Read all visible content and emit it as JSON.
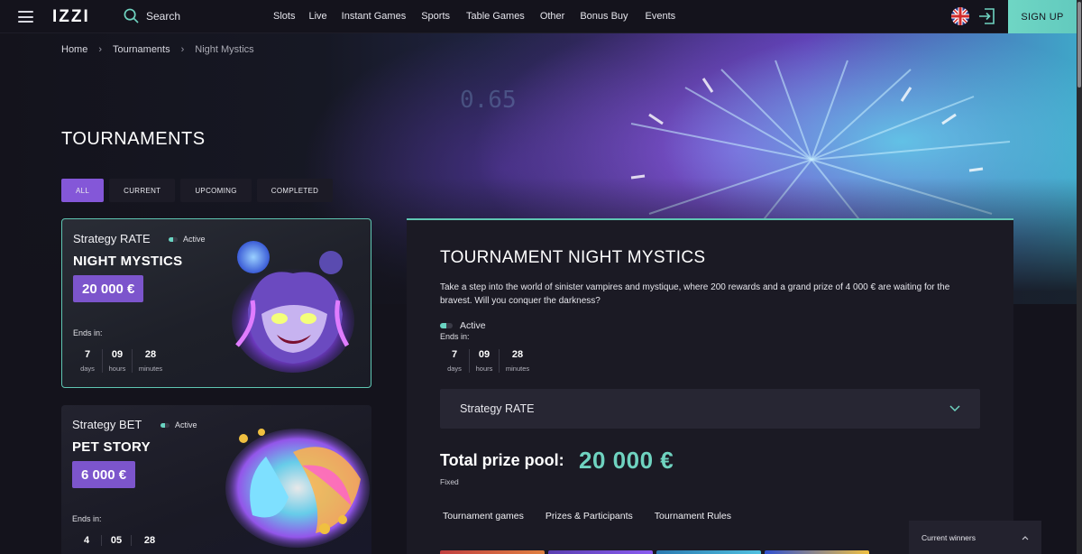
{
  "header": {
    "logo": "IZZI",
    "search_label": "Search",
    "nav": [
      "Slots",
      "Live",
      "Instant Games",
      "Sports",
      "Table Games",
      "Other",
      "Bonus Buy",
      "Events"
    ],
    "signup_label": "SIGN UP"
  },
  "breadcrumb": {
    "home": "Home",
    "tournaments": "Tournaments",
    "current": "Night Mystics"
  },
  "page_title": "TOURNAMENTS",
  "filters": [
    {
      "label": "ALL",
      "active": true
    },
    {
      "label": "CURRENT",
      "active": false
    },
    {
      "label": "UPCOMING",
      "active": false
    },
    {
      "label": "COMPLETED",
      "active": false
    }
  ],
  "cards": [
    {
      "type": "Strategy RATE",
      "status": "Active",
      "name": "NIGHT MYSTICS",
      "prize": "20 000 €",
      "ends_label": "Ends in:",
      "timer": {
        "days": "7",
        "hours": "09",
        "minutes": "28"
      },
      "units": {
        "days": "days",
        "hours": "hours",
        "minutes": "minutes"
      }
    },
    {
      "type": "Strategy BET",
      "status": "Active",
      "name": "PET STORY",
      "prize": "6 000 €",
      "ends_label": "Ends in:",
      "timer": {
        "days": "4",
        "hours": "05",
        "minutes": "28"
      }
    }
  ],
  "detail": {
    "title": "TOURNAMENT NIGHT MYSTICS",
    "description": "Take a step into the world of sinister vampires and mystique, where 200 rewards and a grand prize of 4 000 € are waiting for the bravest. Will you conquer the darkness?",
    "status": "Active",
    "ends_label": "Ends in:",
    "timer": {
      "days": "7",
      "hours": "09",
      "minutes": "28"
    },
    "units": {
      "days": "days",
      "hours": "hours",
      "minutes": "minutes"
    },
    "strategy": "Strategy RATE",
    "prize_label": "Total prize pool:",
    "prize_value": "20 000 €",
    "prize_type": "Fixed",
    "tabs": [
      "Tournament games",
      "Prizes & Participants",
      "Tournament Rules"
    ]
  },
  "winners_label": "Current winners",
  "colors": {
    "accent_teal": "#6fd3c0",
    "accent_purple": "#7c55cc",
    "background": "#14131c"
  }
}
